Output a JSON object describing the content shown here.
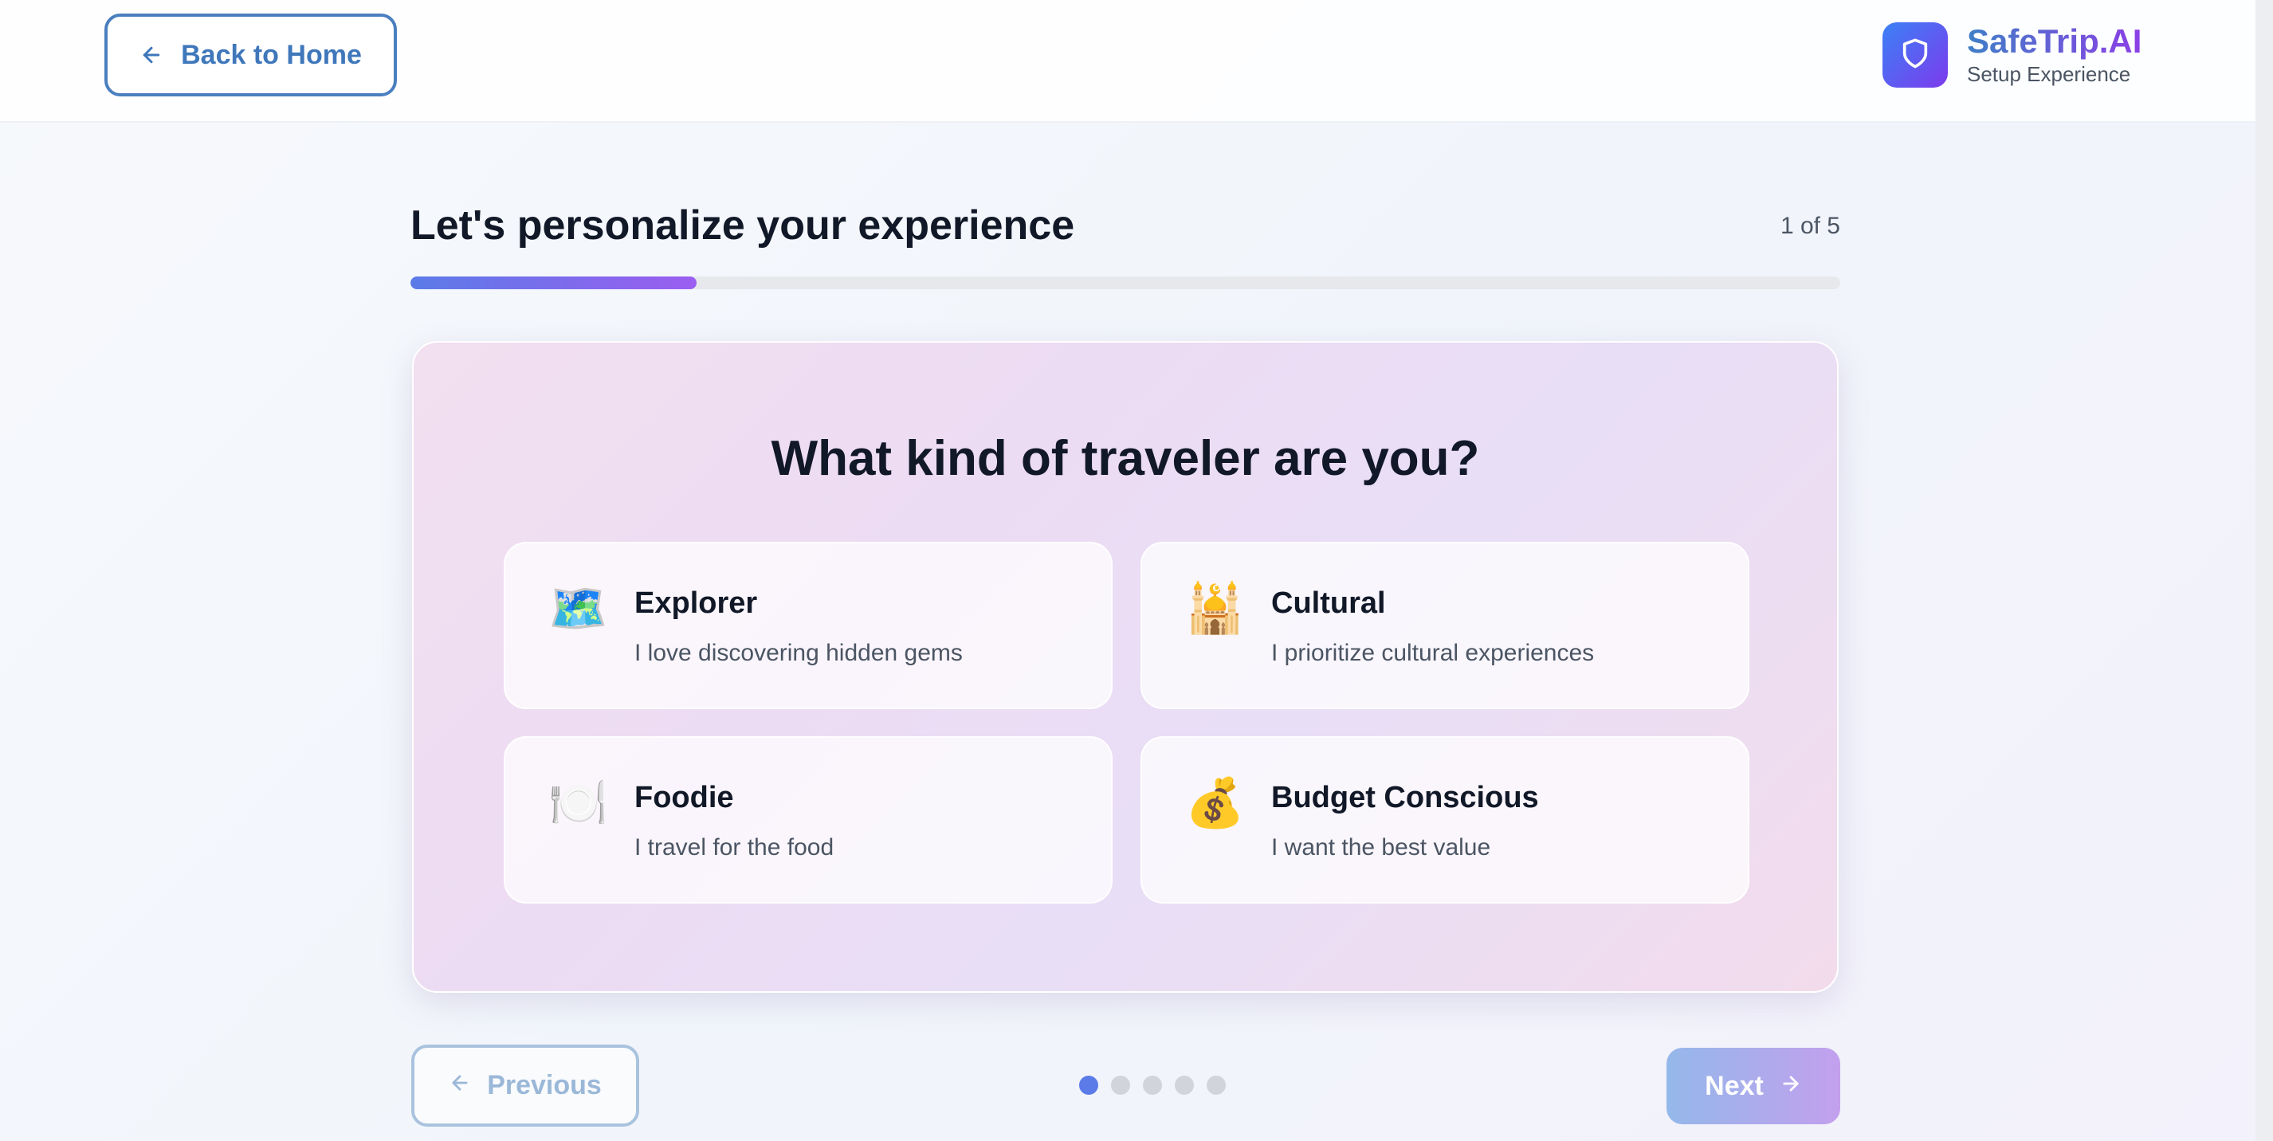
{
  "header": {
    "back_label": "Back to Home",
    "brand_name": "SafeTrip.AI",
    "brand_subtitle": "Setup Experience"
  },
  "onboarding": {
    "title": "Let's personalize your experience",
    "step_counter": "1 of 5",
    "progress_fraction": 0.2,
    "question": "What kind of traveler are you?",
    "options": [
      {
        "emoji": "🗺️",
        "title": "Explorer",
        "description": "I love discovering hidden gems"
      },
      {
        "emoji": "🕌",
        "title": "Cultural",
        "description": "I prioritize cultural experiences"
      },
      {
        "emoji": "🍽️",
        "title": "Foodie",
        "description": "I travel for the food"
      },
      {
        "emoji": "💰",
        "title": "Budget Conscious",
        "description": "I want the best value"
      }
    ]
  },
  "footer": {
    "previous_label": "Previous",
    "next_label": "Next",
    "total_steps": 5,
    "current_step": 1
  },
  "colors": {
    "accent_blue": "#3f77bb",
    "accent_purple": "#8b3fe6",
    "progress_start": "#5b7be8",
    "progress_end": "#9b5ef0"
  },
  "icons": {
    "back": "arrow-left-icon",
    "logo": "shield-icon",
    "previous": "arrow-left-icon",
    "next": "arrow-right-icon"
  }
}
